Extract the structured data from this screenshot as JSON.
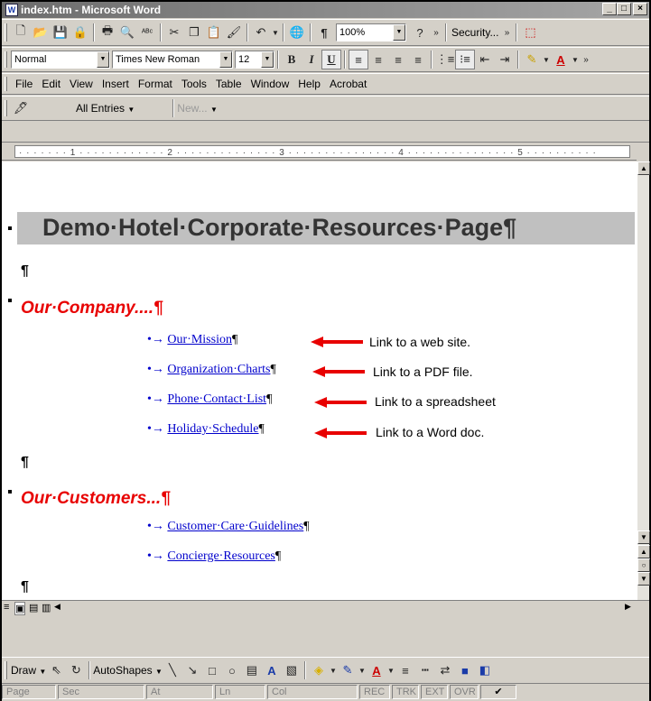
{
  "window": {
    "title": "index.htm - Microsoft Word",
    "app_icon": "W"
  },
  "standard_toolbar": {
    "zoom": "100%",
    "security_label": "Security...",
    "icons": [
      "new-icon",
      "open-icon",
      "save-icon",
      "permission-icon",
      "print-icon",
      "print-preview-icon",
      "spelling-icon",
      "cut-icon",
      "copy-icon",
      "paste-icon",
      "format-painter-icon",
      "undo-icon",
      "hyperlink-icon",
      "show-marks-icon",
      "help-icon"
    ]
  },
  "formatting_toolbar": {
    "style": "Normal",
    "font": "Times New Roman",
    "size": "12"
  },
  "menu": {
    "items": [
      "File",
      "Edit",
      "View",
      "Insert",
      "Format",
      "Tools",
      "Table",
      "Window",
      "Help",
      "Acrobat"
    ]
  },
  "reviewing_toolbar": {
    "entries_label": "All Entries",
    "new_label": "New..."
  },
  "ruler": {
    "numbers": [
      "1",
      "2",
      "3",
      "4",
      "5"
    ]
  },
  "document": {
    "title": "Demo·Hotel·Corporate·Resources·Page¶",
    "empty_para": "¶",
    "sections": [
      {
        "heading": "Our·Company....¶",
        "links": [
          {
            "text": "Our·Mission",
            "note": "Link to a web site."
          },
          {
            "text": "Organization·Charts",
            "note": "Link to a PDF file."
          },
          {
            "text": "Phone·Contact·List",
            "note": "Link to a spreadsheet"
          },
          {
            "text": "Holiday·Schedule",
            "note": "Link to a Word doc."
          }
        ]
      },
      {
        "heading": "Our·Customers...¶",
        "links": [
          {
            "text": "Customer·Care·Guidelines",
            "note": ""
          },
          {
            "text": "Concierge·Resources",
            "note": ""
          }
        ]
      }
    ],
    "bullet_glyph": "•→",
    "pilcrow": "¶"
  },
  "drawing_toolbar": {
    "draw_label": "Draw",
    "autoshapes_label": "AutoShapes"
  },
  "status_bar": {
    "items": [
      "Page",
      "Sec",
      "At",
      "Ln",
      "Col",
      "REC",
      "TRK",
      "EXT",
      "OVR"
    ]
  },
  "colors": {
    "heading_red": "#e80000",
    "link_blue": "#0000cc",
    "arrow_red": "#e80000"
  }
}
